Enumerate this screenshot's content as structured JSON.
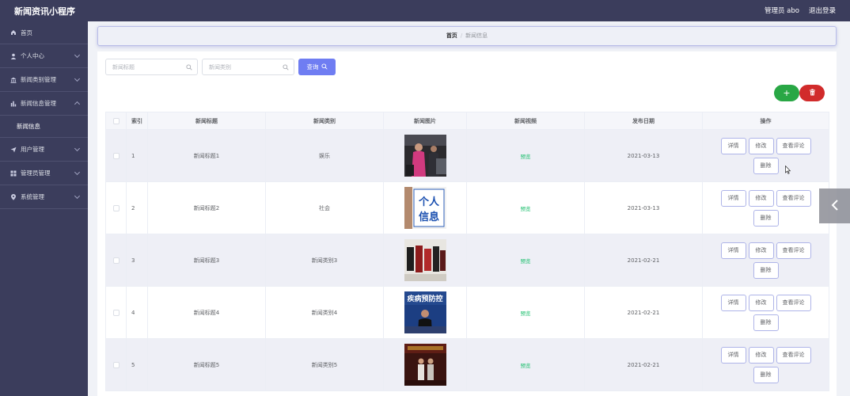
{
  "app": {
    "title": "新闻资讯小程序",
    "user_label": "管理员 abo",
    "logout_label": "退出登录"
  },
  "sidebar": {
    "items": [
      {
        "label": "首页",
        "icon": "home-icon"
      },
      {
        "label": "个人中心",
        "icon": "user-icon"
      },
      {
        "label": "新闻类别管理",
        "icon": "bank-icon"
      },
      {
        "label": "新闻信息管理",
        "icon": "bar-chart-icon"
      },
      {
        "label": "用户管理",
        "icon": "send-icon"
      },
      {
        "label": "管理员管理",
        "icon": "grid-icon"
      },
      {
        "label": "系统管理",
        "icon": "location-icon"
      }
    ],
    "active_sub": "新闻信息"
  },
  "breadcrumb": {
    "home": "首页",
    "separator": "/",
    "current": "新闻信息"
  },
  "search": {
    "title_placeholder": "新闻标题",
    "category_placeholder": "新闻类别",
    "query_label": "查询"
  },
  "actions": {
    "add_symbol": "+"
  },
  "table": {
    "headers": {
      "index": "索引",
      "title": "新闻标题",
      "category": "新闻类别",
      "image": "新闻图片",
      "video": "新闻视频",
      "date": "发布日期",
      "ops": "操作"
    },
    "rows": [
      {
        "index": "1",
        "title": "新闻标题1",
        "category": "娱乐",
        "video": "预览",
        "date": "2021-03-13"
      },
      {
        "index": "2",
        "title": "新闻标题2",
        "category": "社会",
        "video": "预览",
        "date": "2021-03-13"
      },
      {
        "index": "3",
        "title": "新闻标题3",
        "category": "新闻类别3",
        "video": "预览",
        "date": "2021-02-21"
      },
      {
        "index": "4",
        "title": "新闻标题4",
        "category": "新闻类别4",
        "video": "预览",
        "date": "2021-02-21"
      },
      {
        "index": "5",
        "title": "新闻标题5",
        "category": "新闻类别5",
        "video": "预览",
        "date": "2021-02-21"
      }
    ],
    "op_labels": {
      "detail": "详情",
      "edit": "修改",
      "comments": "查看评论",
      "delete": "删除"
    }
  },
  "images": {
    "img2_text_1": "个人",
    "img2_text_2": "信息",
    "img4_text": "疾病预防控"
  },
  "colors": {
    "sidebar_bg": "#3b3d5c",
    "primary": "#6f7df2",
    "success": "#29a745",
    "danger": "#d12b2b",
    "preview": "#19be6b"
  }
}
